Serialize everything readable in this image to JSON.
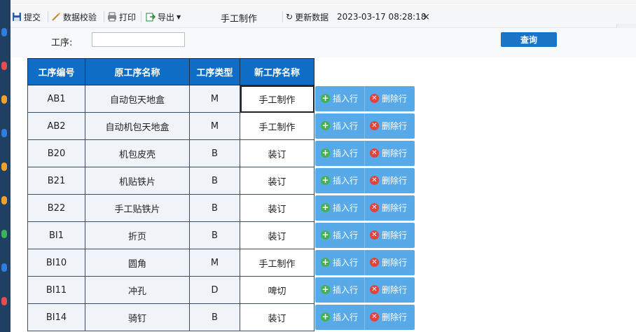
{
  "toolbar": {
    "submit_label": "提交",
    "validate_label": "数据校验",
    "print_label": "打印",
    "export_label": "导出",
    "title": "手工制作",
    "refresh_label": "更新数据",
    "timestamp": "2023-03-17 08:28:18",
    "close_glyph": "×"
  },
  "filter": {
    "process_label": "工序:",
    "process_value": "",
    "query_label": "查询"
  },
  "table": {
    "headers": [
      "工序编号",
      "原工序名称",
      "工序类型",
      "新工序名称"
    ],
    "rows": [
      {
        "code": "AB1",
        "orig": "自动包天地盒",
        "type": "M",
        "new": "手工制作"
      },
      {
        "code": "AB2",
        "orig": "自动机包天地盒",
        "type": "M",
        "new": "手工制作"
      },
      {
        "code": "B20",
        "orig": "机包皮壳",
        "type": "B",
        "new": "装订"
      },
      {
        "code": "B21",
        "orig": "机贴铁片",
        "type": "B",
        "new": "装订"
      },
      {
        "code": "B22",
        "orig": "手工贴铁片",
        "type": "B",
        "new": "装订"
      },
      {
        "code": "BI1",
        "orig": "折页",
        "type": "B",
        "new": "装订"
      },
      {
        "code": "BI10",
        "orig": "圆角",
        "type": "M",
        "new": "手工制作"
      },
      {
        "code": "BI11",
        "orig": "冲孔",
        "type": "D",
        "new": "啤切"
      },
      {
        "code": "BI14",
        "orig": "骑钉",
        "type": "B",
        "new": "装订"
      }
    ]
  },
  "actions": {
    "insert_label": "插入行",
    "delete_label": "删除行"
  },
  "colors": {
    "header_bg": "#0f6dc5",
    "button_bg": "#58a9e8",
    "query_bg": "#1c74c4"
  }
}
